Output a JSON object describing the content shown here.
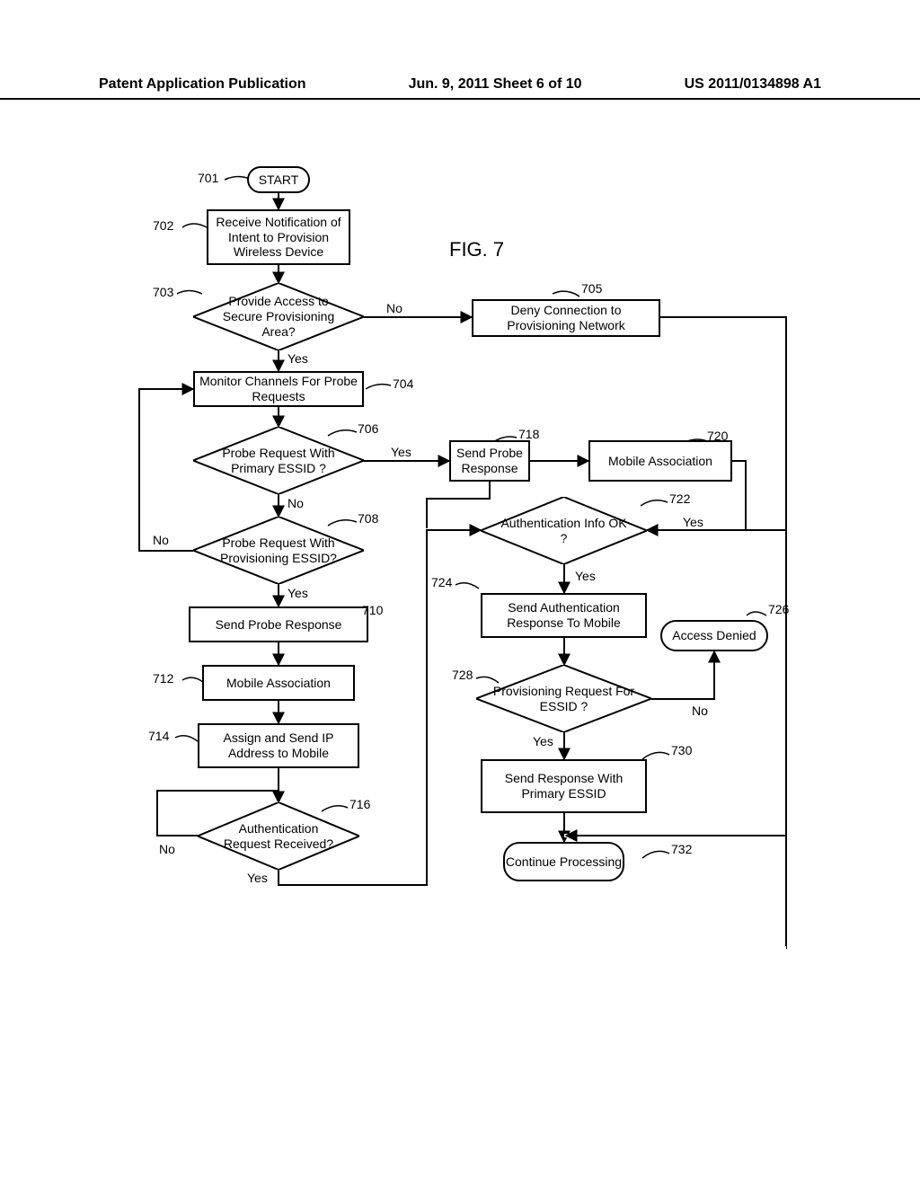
{
  "header": {
    "left": "Patent Application Publication",
    "center": "Jun. 9, 2011  Sheet 6 of 10",
    "right": "US 2011/0134898 A1"
  },
  "figure_title": "FIG. 7",
  "nodes": {
    "n701": "START",
    "n702": "Receive Notification of Intent to Provision Wireless Device",
    "n703": "Provide Access to Secure Provisioning Area?",
    "n704": "Monitor Channels For Probe Requests",
    "n705": "Deny Connection to Provisioning Network",
    "n706": "Probe Request With Primary ESSID ?",
    "n708": "Probe Request With Provisioning ESSID?",
    "n710": "Send Probe Response",
    "n712": "Mobile Association",
    "n714": "Assign and Send IP Address to Mobile",
    "n716": "Authentication Request Received?",
    "n718": "Send Probe Response",
    "n720": "Mobile Association",
    "n722": "Authentication Info OK ?",
    "n724": "Send Authentication Response To Mobile",
    "n726": "Access Denied",
    "n728": "Provisioning Request For ESSID ?",
    "n730": "Send Response With Primary ESSID",
    "n732": "Continue Processing"
  },
  "refs": {
    "r701": "701",
    "r702": "702",
    "r703": "703",
    "r704": "704",
    "r705": "705",
    "r706": "706",
    "r708": "708",
    "r710": "710",
    "r712": "712",
    "r714": "714",
    "r716": "716",
    "r718": "718",
    "r720": "720",
    "r722": "722",
    "r724": "724",
    "r726": "726",
    "r728": "728",
    "r730": "730",
    "r732": "732"
  },
  "edges": {
    "no": "No",
    "yes": "Yes"
  }
}
